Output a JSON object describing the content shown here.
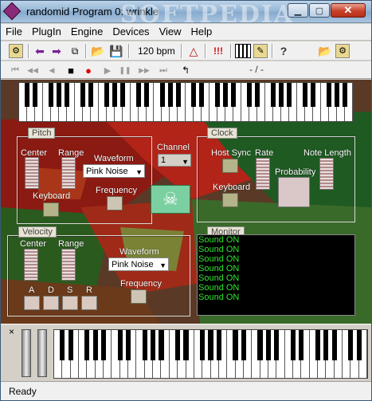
{
  "window": {
    "title": "randomid Program 0: wrinkle",
    "watermark": "SOFTPEDIA",
    "close_glyph": "✕",
    "min_glyph": "▁",
    "max_glyph": "▢"
  },
  "menu": [
    "File",
    "PlugIn",
    "Engine",
    "Devices",
    "View",
    "Help"
  ],
  "toolbar": {
    "bpm": "120 bpm",
    "position": "- / -"
  },
  "icons": {
    "arrow_left": "⬅",
    "arrow_right": "➡",
    "open": "📂",
    "save": "💾",
    "metronome": "△",
    "panic": "!!!",
    "help": "?",
    "stop": "■",
    "record": "●",
    "play": "▶",
    "pause": "❚❚",
    "rewind": "⏮",
    "fast_back": "◀◀",
    "step_back": "◀",
    "step_fwd": "▶",
    "ffwd": "▶▶",
    "end": "⏭"
  },
  "pitch": {
    "title": "Pitch",
    "center": "Center",
    "range": "Range",
    "waveform": "Waveform",
    "waveform_value": "Pink Noise",
    "keyboard": "Keyboard",
    "frequency": "Frequency"
  },
  "channel": {
    "label": "Channel",
    "value": "1"
  },
  "clock": {
    "title": "Clock",
    "host_sync": "Host Sync",
    "rate": "Rate",
    "note_length": "Note Length",
    "probability": "Probability",
    "keyboard": "Keyboard"
  },
  "velocity": {
    "title": "Velocity",
    "center": "Center",
    "range": "Range",
    "waveform": "Waveform",
    "waveform_value": "Pink Noise",
    "frequency": "Frequency",
    "adsr": [
      "A",
      "D",
      "S",
      "R"
    ]
  },
  "monitor": {
    "title": "Monitor",
    "lines": [
      "Sound ON",
      "Sound ON",
      "Sound ON",
      "Sound ON",
      "Sound ON",
      "Sound ON",
      "Sound ON"
    ]
  },
  "bottom": {
    "close_glyph": "×"
  },
  "status": "Ready"
}
